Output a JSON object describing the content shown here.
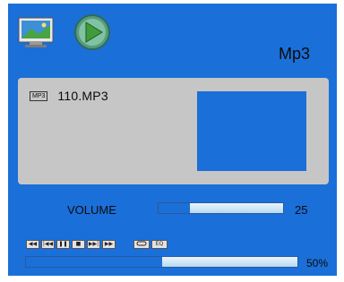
{
  "header": {
    "mode_label": "Mp3",
    "icons": [
      "monitor-icon",
      "play-icon"
    ]
  },
  "now_playing": {
    "type_badge": "MP3",
    "file_name": "110.MP3"
  },
  "volume": {
    "label": "VOLUME",
    "value": "25",
    "level_fraction": 0.25
  },
  "controls": {
    "buttons": [
      "rewind",
      "previous",
      "pause",
      "stop",
      "next",
      "fast-forward"
    ],
    "extras": [
      "repeat",
      "EQ"
    ],
    "eq_label": "EQ"
  },
  "progress": {
    "value_text": "50%",
    "fraction": 0.5
  },
  "colors": {
    "screen_background": "#1b6fd8",
    "panel_background": "#c6c6c6",
    "album_art": "#1b6fd8"
  }
}
